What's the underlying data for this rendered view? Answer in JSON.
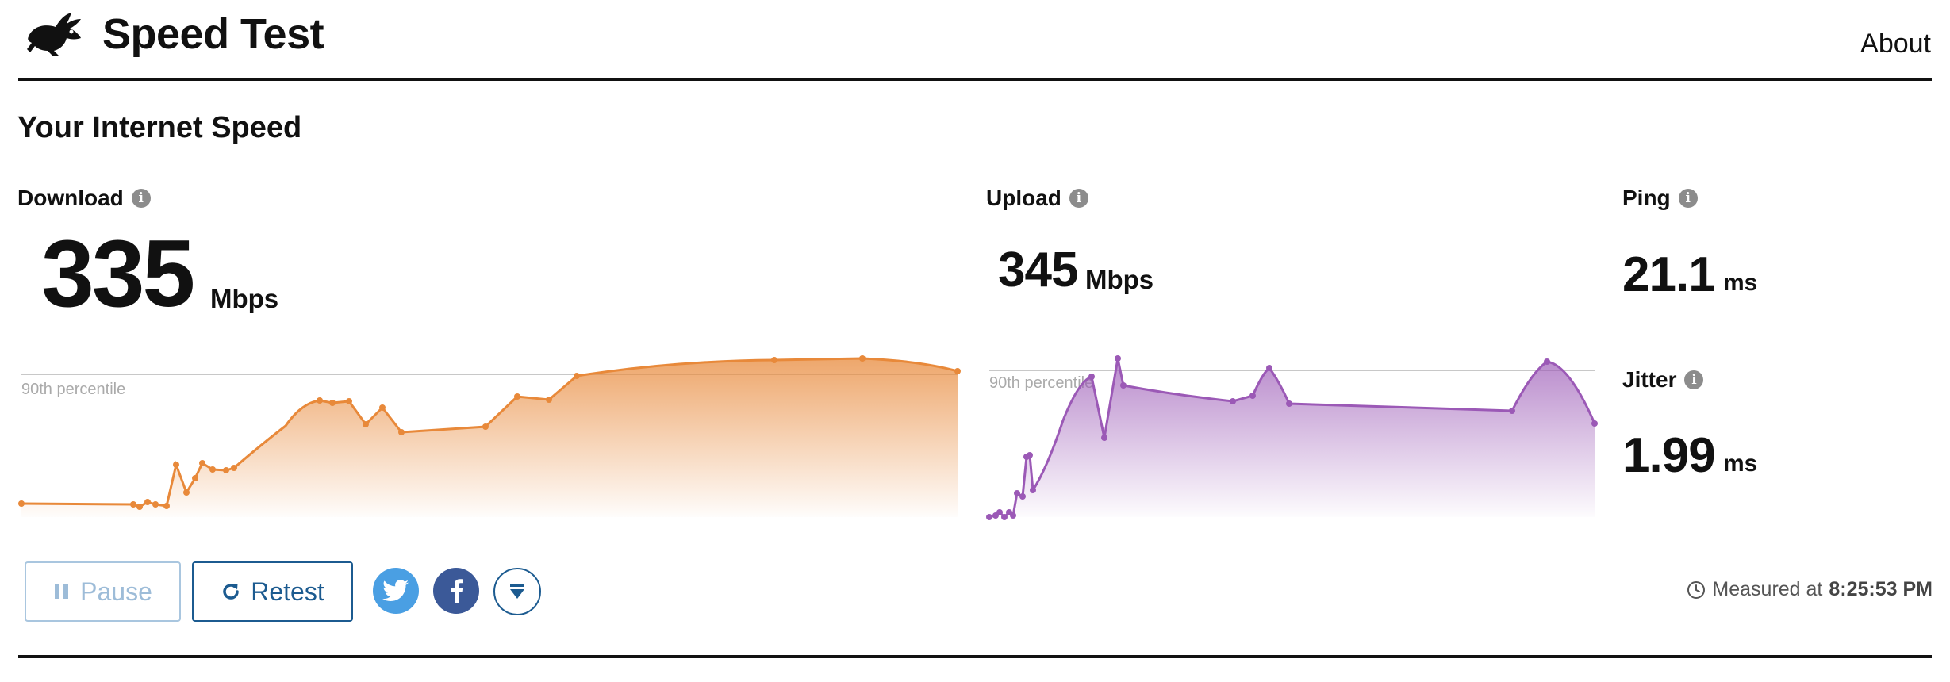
{
  "header": {
    "app_title": "Speed Test",
    "about_label": "About",
    "logo_icon": "rabbit-icon"
  },
  "section_title": "Your Internet Speed",
  "download": {
    "label": "Download",
    "value": "335",
    "unit": "Mbps",
    "percentile_label": "90th percentile"
  },
  "upload": {
    "label": "Upload",
    "value": "345",
    "unit": "Mbps",
    "percentile_label": "90th percentile"
  },
  "ping": {
    "label": "Ping",
    "value": "21.1",
    "unit": "ms"
  },
  "jitter": {
    "label": "Jitter",
    "value": "1.99",
    "unit": "ms"
  },
  "actions": {
    "pause_label": "Pause",
    "retest_label": "Retest",
    "share_icons": [
      "twitter-icon",
      "facebook-icon",
      "download-icon"
    ]
  },
  "measured": {
    "prefix": "Measured at",
    "time": "8:25:53 PM"
  },
  "colors": {
    "download": "#e8893a",
    "upload": "#9b59b6",
    "link": "#1c5b90",
    "twitter": "#4a9fe3",
    "facebook": "#3b5998"
  }
}
